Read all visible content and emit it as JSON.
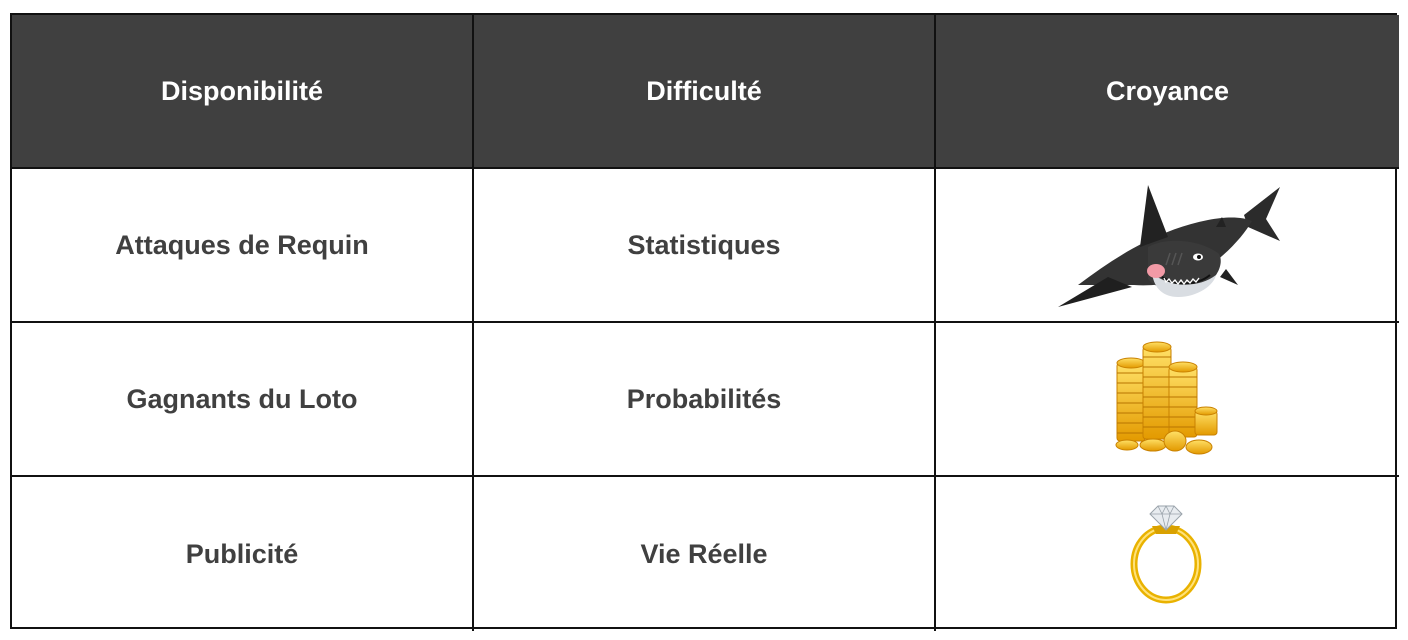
{
  "table": {
    "headers": [
      "Disponibilité",
      "Difficulté",
      "Croyance"
    ],
    "rows": [
      {
        "disponibilite": "Attaques de Requin",
        "difficulte": "Statistiques",
        "croyance_icon": "shark-icon"
      },
      {
        "disponibilite": "Gagnants du Loto",
        "difficulte": "Probabilités",
        "croyance_icon": "gold-coins-icon"
      },
      {
        "disponibilite": "Publicité",
        "difficulte": "Vie Réelle",
        "croyance_icon": "diamond-ring-icon"
      }
    ]
  },
  "colors": {
    "header_bg": "#404040",
    "header_text": "#ffffff",
    "body_text": "#404040",
    "border": "#111111",
    "gold": "#f5b800"
  }
}
